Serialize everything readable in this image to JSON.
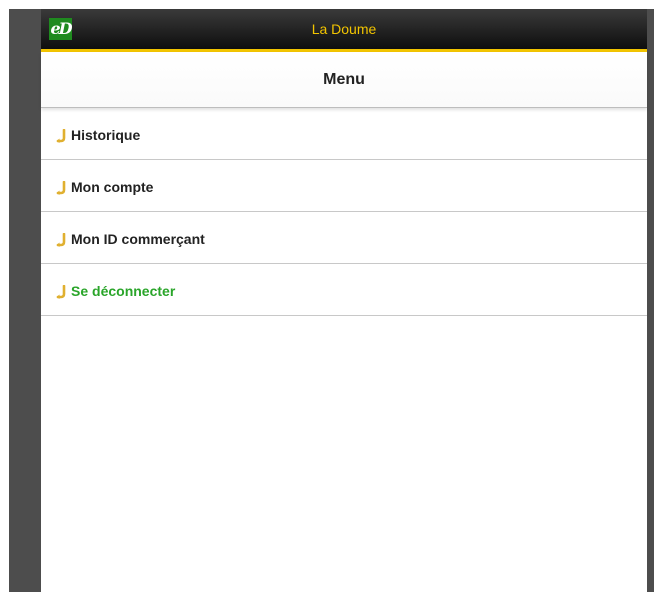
{
  "app": {
    "title": "La Doume",
    "logo_text": "eD",
    "accent_color": "#f2c400",
    "logo_color": "#1f8a1f"
  },
  "header": {
    "title": "Menu"
  },
  "menu": {
    "items": [
      {
        "label": "Historique",
        "icon": "arrow-return-icon",
        "color": "#222222"
      },
      {
        "label": "Mon compte",
        "icon": "arrow-return-icon",
        "color": "#222222"
      },
      {
        "label": "Mon ID commerçant",
        "icon": "arrow-return-icon",
        "color": "#222222"
      },
      {
        "label": "Se déconnecter",
        "icon": "arrow-return-icon",
        "color": "#2aa52a"
      }
    ]
  }
}
